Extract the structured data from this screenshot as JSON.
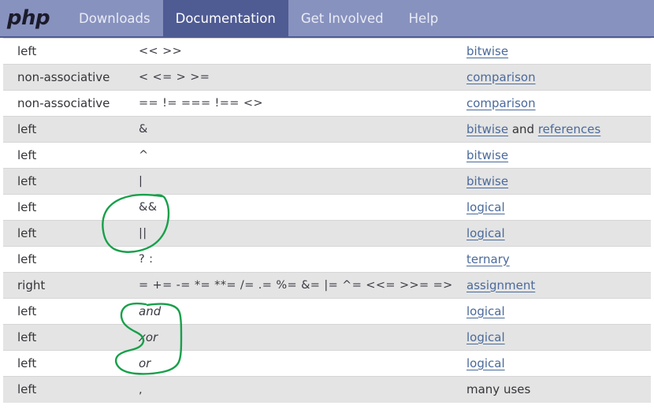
{
  "site": {
    "logo_text": "php",
    "nav": [
      {
        "label": "Downloads",
        "active": false
      },
      {
        "label": "Documentation",
        "active": true
      },
      {
        "label": "Get Involved",
        "active": false
      },
      {
        "label": "Help",
        "active": false
      }
    ]
  },
  "colors": {
    "navbar_bg": "#8892bf",
    "navbar_active_bg": "#4f5b93",
    "row_alt_bg": "#e4e4e4",
    "link": "#4a6a9b",
    "annotation_green": "#17a04a"
  },
  "table": {
    "rows": [
      {
        "associativity": "left",
        "operators": "<< >>",
        "op_style": "code",
        "extra": [
          {
            "text": "bitwise",
            "link": true
          }
        ]
      },
      {
        "associativity": "non-associative",
        "operators": "< <= > >=",
        "op_style": "code",
        "extra": [
          {
            "text": "comparison",
            "link": true
          }
        ]
      },
      {
        "associativity": "non-associative",
        "operators": "== != === !== <>",
        "op_style": "code",
        "extra": [
          {
            "text": "comparison",
            "link": true
          }
        ]
      },
      {
        "associativity": "left",
        "operators": "&",
        "op_style": "code",
        "extra": [
          {
            "text": "bitwise",
            "link": true
          },
          {
            "text": " and ",
            "link": false
          },
          {
            "text": "references",
            "link": true
          }
        ]
      },
      {
        "associativity": "left",
        "operators": "^",
        "op_style": "code",
        "extra": [
          {
            "text": "bitwise",
            "link": true
          }
        ]
      },
      {
        "associativity": "left",
        "operators": "|",
        "op_style": "code",
        "extra": [
          {
            "text": "bitwise",
            "link": true
          }
        ]
      },
      {
        "associativity": "left",
        "operators": "&&",
        "op_style": "code",
        "extra": [
          {
            "text": "logical",
            "link": true
          }
        ]
      },
      {
        "associativity": "left",
        "operators": "||",
        "op_style": "code",
        "extra": [
          {
            "text": "logical",
            "link": true
          }
        ]
      },
      {
        "associativity": "left",
        "operators": "? :",
        "op_style": "code",
        "extra": [
          {
            "text": "ternary",
            "link": true
          }
        ]
      },
      {
        "associativity": "right",
        "operators": "= += -= *= **= /= .= %= &= |= ^= <<= >>= =>",
        "op_style": "code",
        "extra": [
          {
            "text": "assignment",
            "link": true
          }
        ]
      },
      {
        "associativity": "left",
        "operators": "and",
        "op_style": "word",
        "extra": [
          {
            "text": "logical",
            "link": true
          }
        ]
      },
      {
        "associativity": "left",
        "operators": "xor",
        "op_style": "word",
        "extra": [
          {
            "text": "logical",
            "link": true
          }
        ]
      },
      {
        "associativity": "left",
        "operators": "or",
        "op_style": "word",
        "extra": [
          {
            "text": "logical",
            "link": true
          }
        ]
      },
      {
        "associativity": "left",
        "operators": ",",
        "op_style": "code",
        "extra": [
          {
            "text": "many uses",
            "link": false
          }
        ]
      }
    ]
  },
  "annotations": [
    {
      "name": "circle-around-and-or-operators",
      "shape": "hand-drawn-ellipse",
      "encircles": "&& ||"
    },
    {
      "name": "circle-around-word-logical-operators",
      "shape": "hand-drawn-blob",
      "encircles": "and xor or"
    }
  ]
}
